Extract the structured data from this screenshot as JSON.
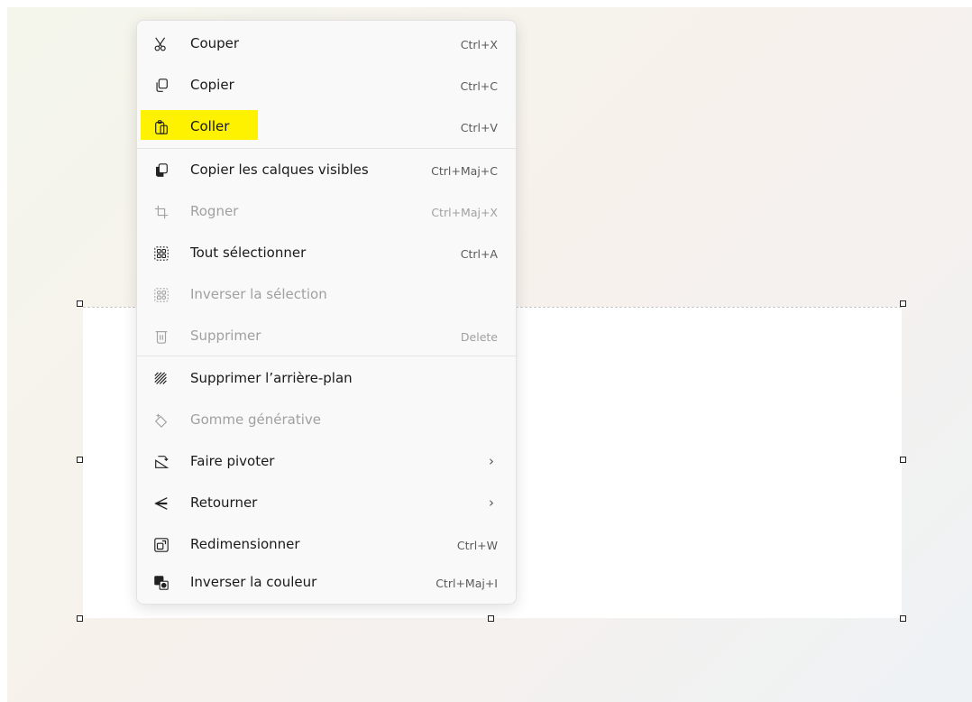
{
  "menu": {
    "items": [
      {
        "label": "Couper",
        "shortcut": "Ctrl+X",
        "icon": "scissors-icon",
        "enabled": true
      },
      {
        "label": "Copier",
        "shortcut": "Ctrl+C",
        "icon": "copy-icon",
        "enabled": true
      },
      {
        "label": "Coller",
        "shortcut": "Ctrl+V",
        "icon": "paste-icon",
        "enabled": true,
        "highlighted": true
      },
      {
        "label": "Copier les calques visibles",
        "shortcut": "Ctrl+Maj+C",
        "icon": "copy-layers-icon",
        "enabled": true
      },
      {
        "label": "Rogner",
        "shortcut": "Ctrl+Maj+X",
        "icon": "crop-icon",
        "enabled": false
      },
      {
        "label": "Tout sélectionner",
        "shortcut": "Ctrl+A",
        "icon": "select-all-icon",
        "enabled": true
      },
      {
        "label": "Inverser la sélection",
        "shortcut": "",
        "icon": "invert-selection-icon",
        "enabled": false
      },
      {
        "label": "Supprimer",
        "shortcut": "Delete",
        "icon": "trash-icon",
        "enabled": false
      },
      {
        "label": "Supprimer l’arrière-plan",
        "shortcut": "",
        "icon": "remove-background-icon",
        "enabled": true
      },
      {
        "label": "Gomme générative",
        "shortcut": "",
        "icon": "generative-eraser-icon",
        "enabled": false
      },
      {
        "label": "Faire pivoter",
        "shortcut": "",
        "icon": "rotate-icon",
        "enabled": true,
        "submenu": "›"
      },
      {
        "label": "Retourner",
        "shortcut": "",
        "icon": "flip-icon",
        "enabled": true,
        "submenu": "›"
      },
      {
        "label": "Redimensionner",
        "shortcut": "Ctrl+W",
        "icon": "resize-icon",
        "enabled": true
      },
      {
        "label": "Inverser la couleur",
        "shortcut": "Ctrl+Maj+I",
        "icon": "invert-color-icon",
        "enabled": true
      }
    ]
  },
  "colors": {
    "highlight": "#fff200",
    "disabled_text": "#a0a0a0"
  }
}
